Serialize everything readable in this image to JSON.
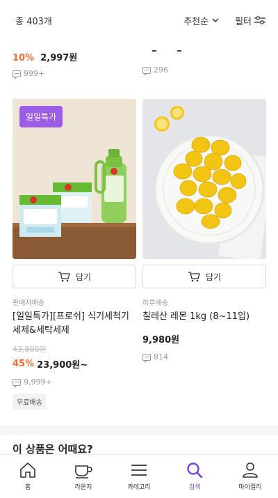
{
  "header": {
    "count": "총 403개",
    "sort": "추천순",
    "filter": "필터"
  },
  "prev_row": {
    "left": {
      "discount": "10%",
      "price": "2,997원",
      "reviews": "999+"
    },
    "right": {
      "reviews": "296"
    }
  },
  "products": [
    {
      "badge": "일일특가",
      "cart": "담기",
      "shipping": "판매자배송",
      "name": "[일일특가][프로쉬] 식기세척기세제&세탁세제",
      "original_price": "43,800원",
      "discount": "45%",
      "price": "23,900원~",
      "reviews": "9,999+",
      "tag": "무료배송"
    },
    {
      "cart": "담기",
      "shipping": "하루배송",
      "name": "칠레산 레몬 1kg (8~11입)",
      "price": "9,980원",
      "reviews": "814"
    }
  ],
  "section": {
    "title": "이 상품은 어때요?"
  },
  "nav": [
    {
      "label": "홈",
      "icon": "home-icon"
    },
    {
      "label": "라운지",
      "icon": "cup-icon"
    },
    {
      "label": "카테고리",
      "icon": "menu-icon"
    },
    {
      "label": "검색",
      "icon": "search-icon",
      "active": true
    },
    {
      "label": "마이컬리",
      "icon": "user-icon"
    }
  ],
  "colors": {
    "accent": "#7b3fe4",
    "discount": "#f36f3a",
    "badge": "#9b5de5"
  }
}
